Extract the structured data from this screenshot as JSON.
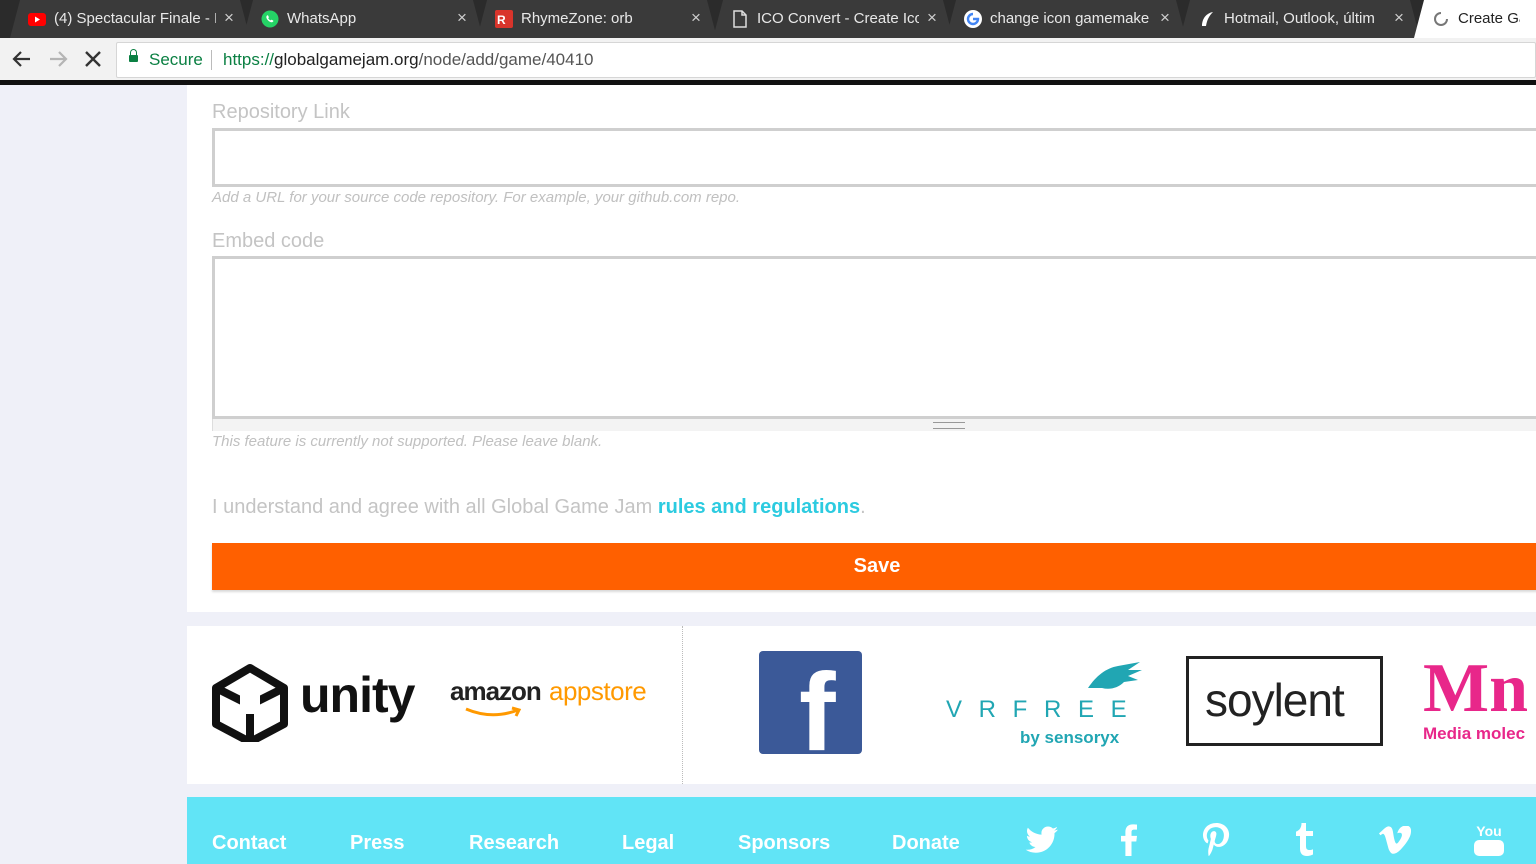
{
  "browser": {
    "tabs": [
      {
        "title": "(4) Spectacular Finale - F",
        "icon": "youtube-icon"
      },
      {
        "title": "WhatsApp",
        "icon": "whatsapp-icon"
      },
      {
        "title": "RhymeZone: orb",
        "icon": "rhymezone-icon"
      },
      {
        "title": "ICO Convert - Create Ico",
        "icon": "document-icon"
      },
      {
        "title": "change icon gamemake",
        "icon": "google-icon"
      },
      {
        "title": "Hotmail, Outlook, últim",
        "icon": "outlook-icon"
      },
      {
        "title": "Create Gam",
        "icon": "loading-icon"
      }
    ],
    "security_label": "Secure",
    "url": {
      "scheme": "https://",
      "host": "globalgamejam.org",
      "path": "/node/add/game/40410"
    }
  },
  "form": {
    "repository": {
      "label": "Repository Link",
      "value": "",
      "help": "Add a URL for your source code repository. For example, your github.com repo."
    },
    "embed": {
      "label": "Embed code",
      "value": "",
      "help": "This feature is currently not supported. Please leave blank."
    },
    "agreement": {
      "text": "I understand and agree with all Global Game Jam ",
      "link": "rules and regulations",
      "end": "."
    },
    "save_label": "Save"
  },
  "sponsors": [
    {
      "name": "unity",
      "icon": "unity-logo-icon"
    },
    {
      "name": "amazon",
      "name2": "appstore",
      "icon": "amazon-appstore-logo"
    },
    {
      "name": "f",
      "icon": "facebook-logo-icon"
    },
    {
      "name": "V R F R E E",
      "sub": "by sensoryx",
      "icon": "vrfree-logo"
    },
    {
      "name": "soylent",
      "icon": "soylent-logo"
    },
    {
      "name": "Mn",
      "sub": "Media molec",
      "icon": "media-molecule-logo"
    }
  ],
  "footer": {
    "links": [
      "Contact",
      "Press",
      "Research",
      "Legal",
      "Sponsors",
      "Donate"
    ],
    "social": [
      "twitter-icon",
      "facebook-icon",
      "pinterest-icon",
      "tumblr-icon",
      "vimeo-icon",
      "youtube-icon"
    ],
    "youtube_label": "You"
  },
  "colors": {
    "accent": "#ff6000",
    "link": "#2ccbe0",
    "footer": "#61e4f6",
    "facebook": "#3b5998",
    "media_molecule": "#e8278a",
    "vrfree": "#21a6b3",
    "amazon_orange": "#ff9900"
  }
}
